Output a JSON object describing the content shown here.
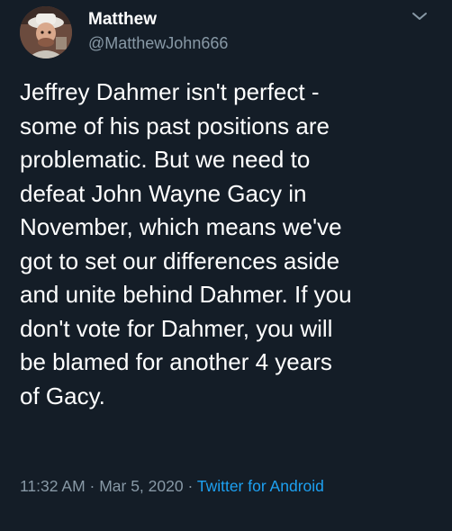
{
  "tweet": {
    "author": {
      "display_name": "Matthew",
      "handle": "@MatthewJohn666",
      "avatar_icon": "avatar-photo"
    },
    "menu_icon": "chevron-down-icon",
    "text": "Jeffrey Dahmer isn't perfect -\nsome of his past positions are\nproblematic. But we need to\ndefeat John Wayne Gacy in\nNovember, which means we've\ngot to set our differences aside\nand unite behind Dahmer. If you\ndon't vote for Dahmer, you will\nbe blamed for another 4 years\nof Gacy.",
    "time": "11:32 AM",
    "date": "Mar 5, 2020",
    "separator": " · ",
    "source": "Twitter for Android"
  },
  "colors": {
    "background": "#141d27",
    "text": "#ffffff",
    "secondary": "#8899a6",
    "link": "#1da1f2"
  }
}
